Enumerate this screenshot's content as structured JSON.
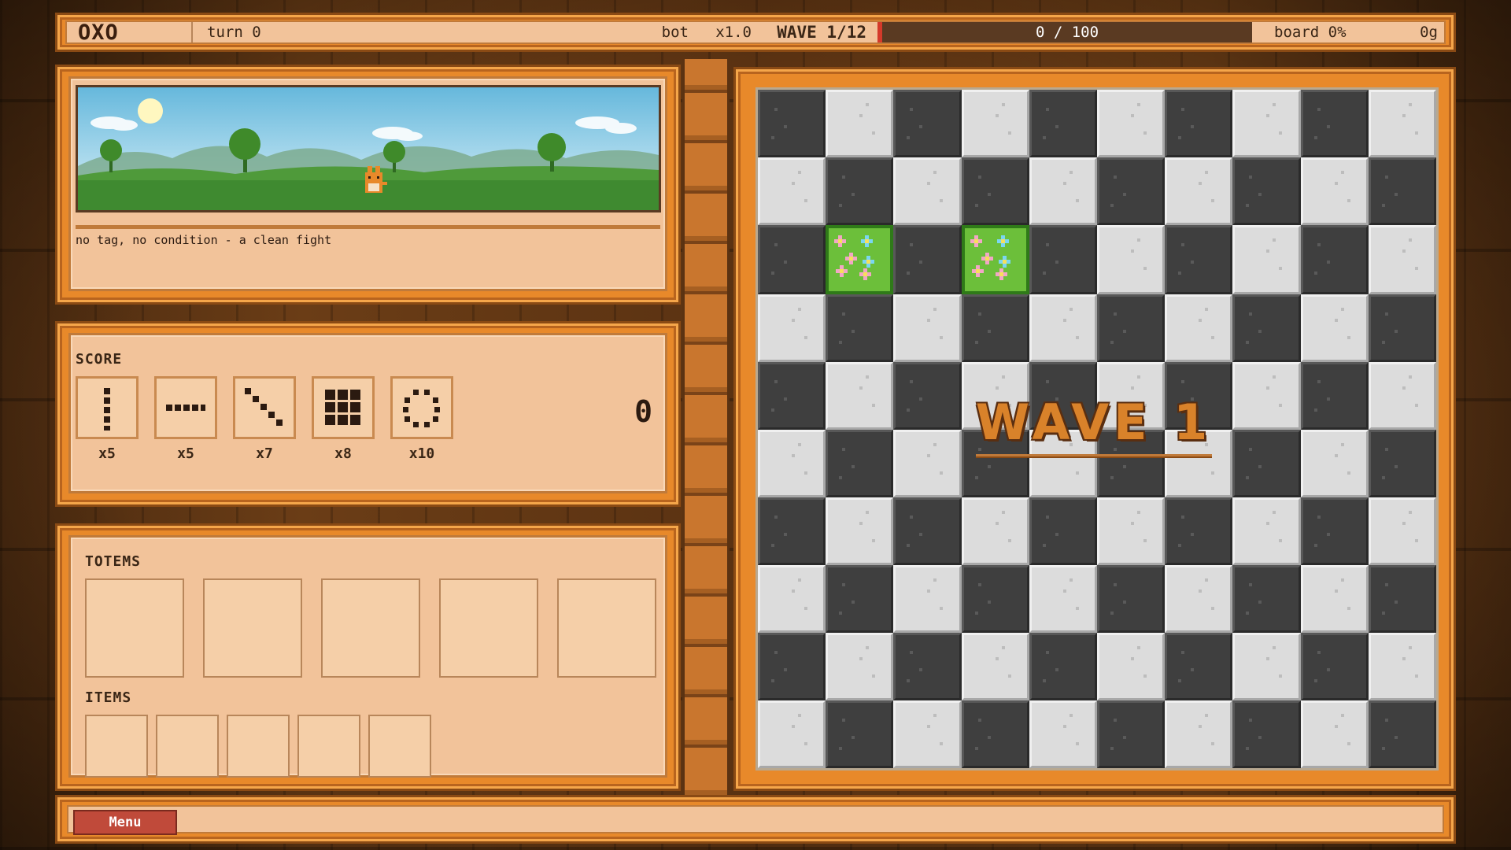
{
  "topbar": {
    "logo": "OXO",
    "turn": "turn 0",
    "mode": "bot",
    "multiplier": "x1.0",
    "wave": "WAVE 1/12",
    "progress_text": "0 / 100",
    "progress_fraction": 0,
    "board": "board 0%",
    "gold": "0g"
  },
  "scene": {
    "caption": "no tag, no condition - a clean fight"
  },
  "score": {
    "title": "SCORE",
    "value": "0",
    "patterns": [
      {
        "icon": "vertical-line-icon",
        "mult": "x5"
      },
      {
        "icon": "horizontal-line-icon",
        "mult": "x5"
      },
      {
        "icon": "diagonal-line-icon",
        "mult": "x7"
      },
      {
        "icon": "grid-square-icon",
        "mult": "x8"
      },
      {
        "icon": "ring-icon",
        "mult": "x10"
      }
    ]
  },
  "inventory": {
    "totems_title": "TOTEMS",
    "items_title": "ITEMS"
  },
  "board": {
    "rows": 10,
    "cols": 10,
    "flower_cells": [
      [
        2,
        1
      ],
      [
        2,
        3
      ]
    ]
  },
  "banner": {
    "text": "WAVE 1"
  },
  "bottombar": {
    "menu_label": "Menu"
  },
  "colors": {
    "frame": "#e8892a",
    "panel": "#f2c39a",
    "progress": "#d43a2a",
    "menu": "#c04a3a"
  }
}
